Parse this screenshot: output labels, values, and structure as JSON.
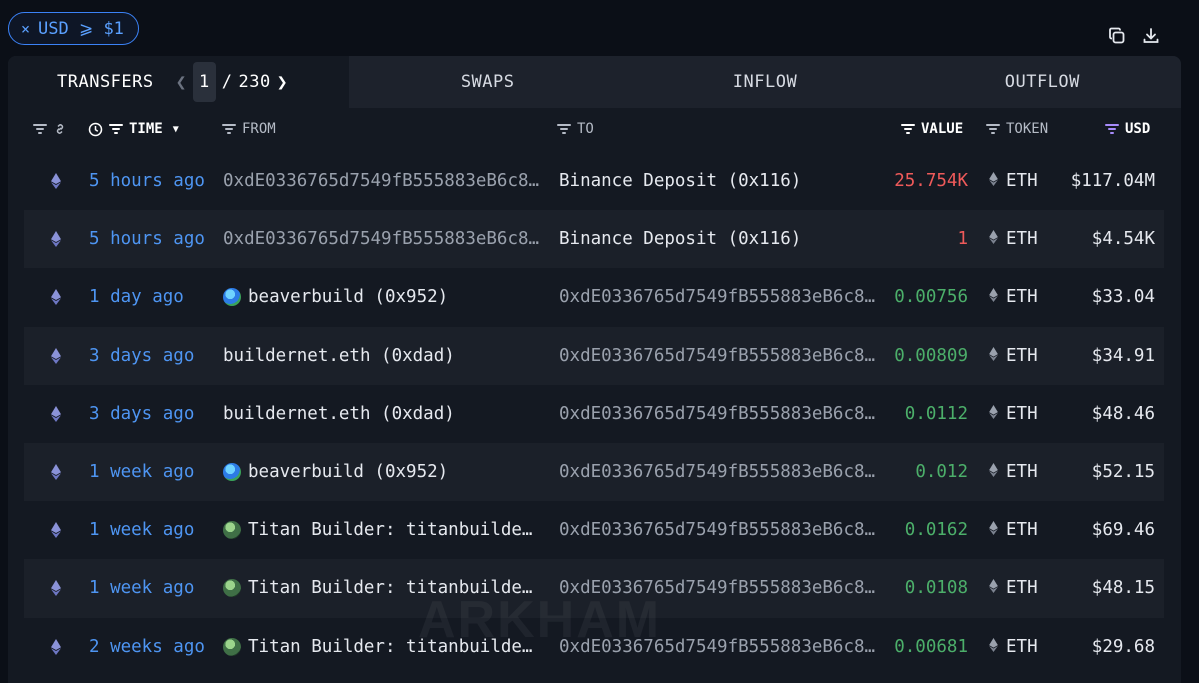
{
  "filter_chip": {
    "close": "×",
    "label": "USD ⩾ $1"
  },
  "tabs": {
    "transfers": "TRANSFERS",
    "page_current": "1",
    "page_sep": "/",
    "page_total": "230",
    "swaps": "SWAPS",
    "inflow": "INFLOW",
    "outflow": "OUTFLOW"
  },
  "columns": {
    "time": "TIME",
    "from": "FROM",
    "to": "TO",
    "value": "VALUE",
    "token": "TOKEN",
    "usd": "USD"
  },
  "watermark": "ARKHAM",
  "colors": {
    "accent": "#4e95f2",
    "outflow": "#ef5a5a",
    "inflow": "#4caf6a",
    "purple": "#a78bfa"
  },
  "rows": [
    {
      "time": "5 hours ago",
      "from": "0xdE0336765d7549fB555883eB6c8…",
      "from_icon": "",
      "to": "Binance Deposit (0x116)",
      "value": "25.754K",
      "dir": "out",
      "token": "ETH",
      "usd": "$117.04M"
    },
    {
      "time": "5 hours ago",
      "from": "0xdE0336765d7549fB555883eB6c8…",
      "from_icon": "",
      "to": "Binance Deposit (0x116)",
      "value": "1",
      "dir": "out",
      "token": "ETH",
      "usd": "$4.54K"
    },
    {
      "time": "1 day ago",
      "from": "beaverbuild (0x952)",
      "from_icon": "globe",
      "to": "0xdE0336765d7549fB555883eB6c8…",
      "value": "0.00756",
      "dir": "in",
      "token": "ETH",
      "usd": "$33.04"
    },
    {
      "time": "3 days ago",
      "from": "buildernet.eth (0xdad)",
      "from_icon": "",
      "to": "0xdE0336765d7549fB555883eB6c8…",
      "value": "0.00809",
      "dir": "in",
      "token": "ETH",
      "usd": "$34.91"
    },
    {
      "time": "3 days ago",
      "from": "buildernet.eth (0xdad)",
      "from_icon": "",
      "to": "0xdE0336765d7549fB555883eB6c8…",
      "value": "0.0112",
      "dir": "in",
      "token": "ETH",
      "usd": "$48.46"
    },
    {
      "time": "1 week ago",
      "from": "beaverbuild (0x952)",
      "from_icon": "globe",
      "to": "0xdE0336765d7549fB555883eB6c8…",
      "value": "0.012",
      "dir": "in",
      "token": "ETH",
      "usd": "$52.15"
    },
    {
      "time": "1 week ago",
      "from": "Titan Builder: titanbuilde…",
      "from_icon": "titan",
      "to": "0xdE0336765d7549fB555883eB6c8…",
      "value": "0.0162",
      "dir": "in",
      "token": "ETH",
      "usd": "$69.46"
    },
    {
      "time": "1 week ago",
      "from": "Titan Builder: titanbuilde…",
      "from_icon": "titan",
      "to": "0xdE0336765d7549fB555883eB6c8…",
      "value": "0.0108",
      "dir": "in",
      "token": "ETH",
      "usd": "$48.15"
    },
    {
      "time": "2 weeks ago",
      "from": "Titan Builder: titanbuilde…",
      "from_icon": "titan",
      "to": "0xdE0336765d7549fB555883eB6c8…",
      "value": "0.00681",
      "dir": "in",
      "token": "ETH",
      "usd": "$29.68"
    }
  ]
}
